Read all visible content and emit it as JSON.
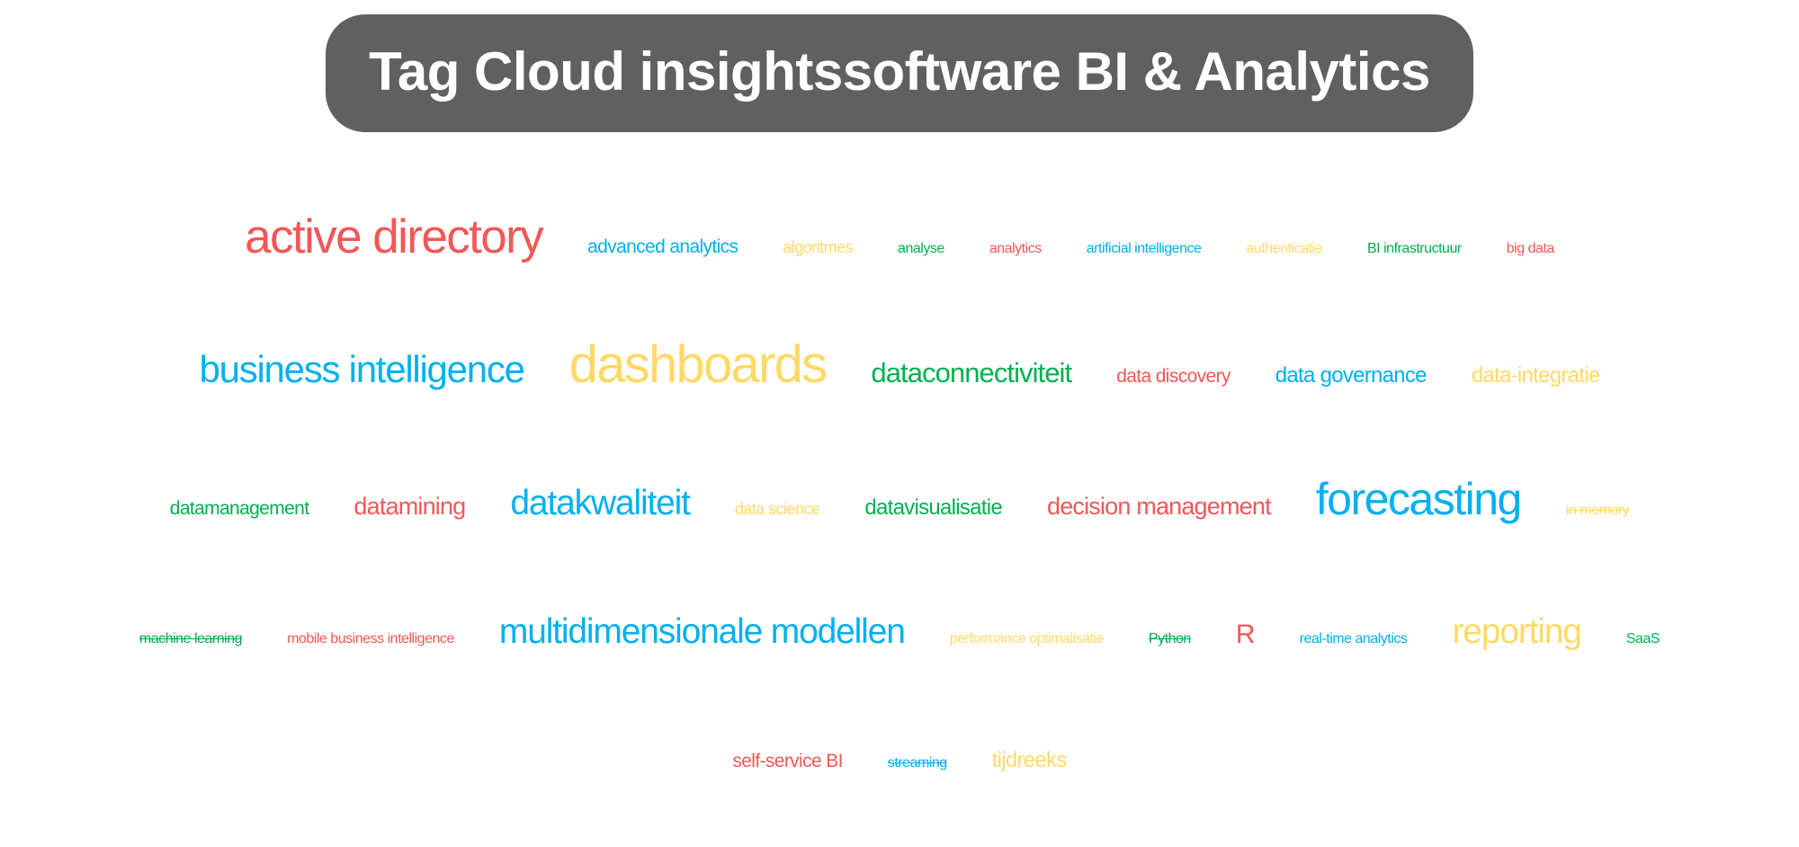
{
  "title": "Tag Cloud insightssoftware BI & Analytics",
  "colors": {
    "title_bar": "#606060",
    "title_text": "#FFFFFF",
    "red": "#F25757",
    "blue": "#00B0F0",
    "yellow": "#FFD966",
    "green": "#00B050",
    "background": "#FFFFFF"
  },
  "rows": [
    {
      "tags": [
        {
          "label": "active directory",
          "color": "red",
          "size": "sz-hh",
          "strikethrough": false
        },
        {
          "label": "advanced analytics",
          "color": "blue",
          "size": "sz-sm",
          "strikethrough": false
        },
        {
          "label": "algoritmes",
          "color": "yellow",
          "size": "sz-s",
          "strikethrough": false
        },
        {
          "label": "analyse",
          "color": "green",
          "size": "sz-xs",
          "strikethrough": false
        },
        {
          "label": "analytics",
          "color": "red",
          "size": "sz-xs",
          "strikethrough": false
        },
        {
          "label": "artificial intelligence",
          "color": "blue",
          "size": "sz-xs",
          "strikethrough": false
        },
        {
          "label": "authenticatie",
          "color": "yellow",
          "size": "sz-xs",
          "strikethrough": false
        },
        {
          "label": "BI infrastructuur",
          "color": "green",
          "size": "sz-xs",
          "strikethrough": false
        },
        {
          "label": "big data",
          "color": "red",
          "size": "sz-xs",
          "strikethrough": false
        }
      ]
    },
    {
      "tags": [
        {
          "label": "business intelligence",
          "color": "blue",
          "size": "sz-xxl",
          "strikethrough": false
        },
        {
          "label": "dashboards",
          "color": "yellow",
          "size": "sz-max",
          "strikethrough": false
        },
        {
          "label": "dataconnectiviteit",
          "color": "green",
          "size": "sz-l",
          "strikethrough": false
        },
        {
          "label": "data discovery",
          "color": "red",
          "size": "sz-sm",
          "strikethrough": false
        },
        {
          "label": "data governance",
          "color": "blue",
          "size": "sz-m",
          "strikethrough": false
        },
        {
          "label": "data-integratie",
          "color": "yellow",
          "size": "sz-m",
          "strikethrough": false
        }
      ]
    },
    {
      "tags": [
        {
          "label": "datamanagement",
          "color": "green",
          "size": "sz-sm",
          "strikethrough": false
        },
        {
          "label": "datamining",
          "color": "red",
          "size": "sz-ml",
          "strikethrough": false
        },
        {
          "label": "datakwaliteit",
          "color": "blue",
          "size": "sz-xl",
          "strikethrough": false
        },
        {
          "label": "data science",
          "color": "yellow",
          "size": "sz-s",
          "strikethrough": false
        },
        {
          "label": "datavisualisatie",
          "color": "green",
          "size": "sz-m",
          "strikethrough": false
        },
        {
          "label": "decision management",
          "color": "red",
          "size": "sz-ml",
          "strikethrough": false
        },
        {
          "label": "forecasting",
          "color": "blue",
          "size": "sz-h",
          "strikethrough": false
        },
        {
          "label": "in memory",
          "color": "yellow",
          "size": "sz-xs",
          "strikethrough": true
        }
      ]
    },
    {
      "tags": [
        {
          "label": "machine learning",
          "color": "green",
          "size": "sz-xs",
          "strikethrough": true
        },
        {
          "label": "mobile business intelligence",
          "color": "red",
          "size": "sz-xs",
          "strikethrough": false
        },
        {
          "label": "multidimensionale modellen",
          "color": "blue",
          "size": "sz-xl",
          "strikethrough": false
        },
        {
          "label": "performance optimalisatie",
          "color": "yellow",
          "size": "sz-xs",
          "strikethrough": false
        },
        {
          "label": "Python",
          "color": "green",
          "size": "sz-xs",
          "strikethrough": true
        },
        {
          "label": "R",
          "color": "red",
          "size": "sz-r",
          "strikethrough": false
        },
        {
          "label": "real-time analytics",
          "color": "blue",
          "size": "sz-xs",
          "strikethrough": false
        },
        {
          "label": "reporting",
          "color": "yellow",
          "size": "sz-xl",
          "strikethrough": false
        },
        {
          "label": "SaaS",
          "color": "green",
          "size": "sz-xs",
          "strikethrough": false
        }
      ]
    },
    {
      "tags": [
        {
          "label": "self-service BI",
          "color": "red",
          "size": "sz-sm",
          "strikethrough": false
        },
        {
          "label": "streaming",
          "color": "blue",
          "size": "sz-xs",
          "strikethrough": true
        },
        {
          "label": "tijdreeks",
          "color": "yellow",
          "size": "sz-m",
          "strikethrough": false
        }
      ]
    }
  ]
}
